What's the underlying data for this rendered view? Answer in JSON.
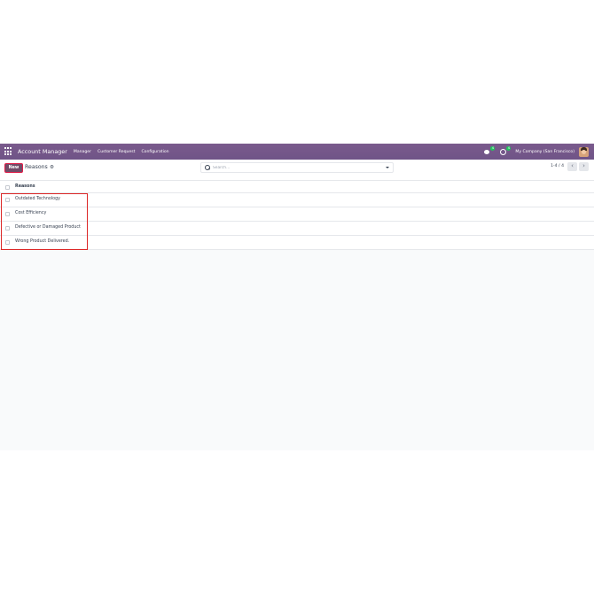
{
  "navbar": {
    "app_title": "Account Manager",
    "menu": [
      "Manager",
      "Customer Request",
      "Configuration"
    ],
    "messages_badge": "4",
    "activity_badge": "4",
    "company": "My Company (San Francisco)"
  },
  "control_panel": {
    "new_label": "New",
    "title": "Reasons",
    "search_placeholder": "Search...",
    "pager": "1-4 / 4",
    "prev_label": "‹",
    "next_label": "›"
  },
  "table": {
    "header": "Reasons",
    "rows": [
      "Outdated Technology",
      "Cost Efficiency",
      "Defective or Damaged Product",
      "Wrong Product Delivered."
    ]
  },
  "colors": {
    "navbar": "#714b67",
    "primary": "#714b67",
    "highlight": "#dc2626"
  }
}
